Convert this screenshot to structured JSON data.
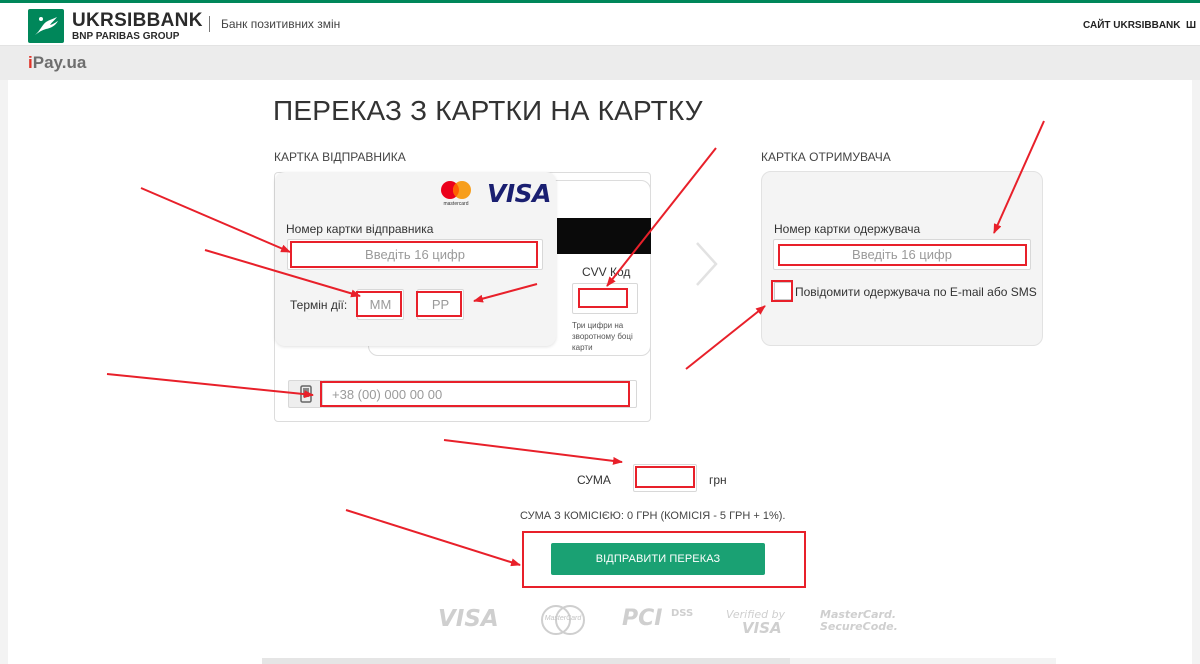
{
  "header": {
    "bank_name": "UKRSIBBANK",
    "bank_group": "BNP PARIBAS GROUP",
    "tagline": "Банк позитивних змін",
    "site_link": "САЙТ UKRSIBBANK",
    "site_link_2": "Ш"
  },
  "subbar": {
    "brand_i": "i",
    "brand_rest": "Pay.ua"
  },
  "page": {
    "title": "ПЕРЕКАЗ З КАРТКИ НА КАРТКУ"
  },
  "sender": {
    "section_label": "КАРТКА ВІДПРАВНИКА",
    "card_brand_mc": "mastercard",
    "card_brand_visa": "VISA",
    "card_number_label": "Номер картки відправника",
    "card_number_placeholder": "Введіть 16 цифр",
    "expiry_label": "Термін дії:",
    "month_placeholder": "ММ",
    "year_placeholder": "РР",
    "cvv_label": "CVV Код",
    "cvv_hint": "Три цифри на зворотному боці карти",
    "phone_placeholder": "+38 (00) 000 00 00"
  },
  "receiver": {
    "section_label": "КАРТКА ОТРИМУВАЧА",
    "card_number_label": "Номер картки одержувача",
    "card_number_placeholder": "Введіть 16 цифр",
    "notify_label": "Повідомити одержувача по E-mail або SMS"
  },
  "amount": {
    "label": "СУМА",
    "currency": "грн",
    "commission_text": "СУМА З КОМІСІЄЮ: 0 ГРН (КОМІСІЯ - 5 ГРН + 1%)."
  },
  "send_button": "ВІДПРАВИТИ ПЕРЕКАЗ",
  "payment_logos": {
    "visa": "VISA",
    "mastercard": "MasterCard",
    "pci": "PCI",
    "dss": "DSS",
    "verified_1": "Verified by",
    "verified_2": "VISA",
    "securecode_1": "MasterCard.",
    "securecode_2": "SecureCode."
  },
  "colors": {
    "accent": "#1aa173",
    "brand_green": "#00875a",
    "annotation_red": "#e8202a"
  }
}
